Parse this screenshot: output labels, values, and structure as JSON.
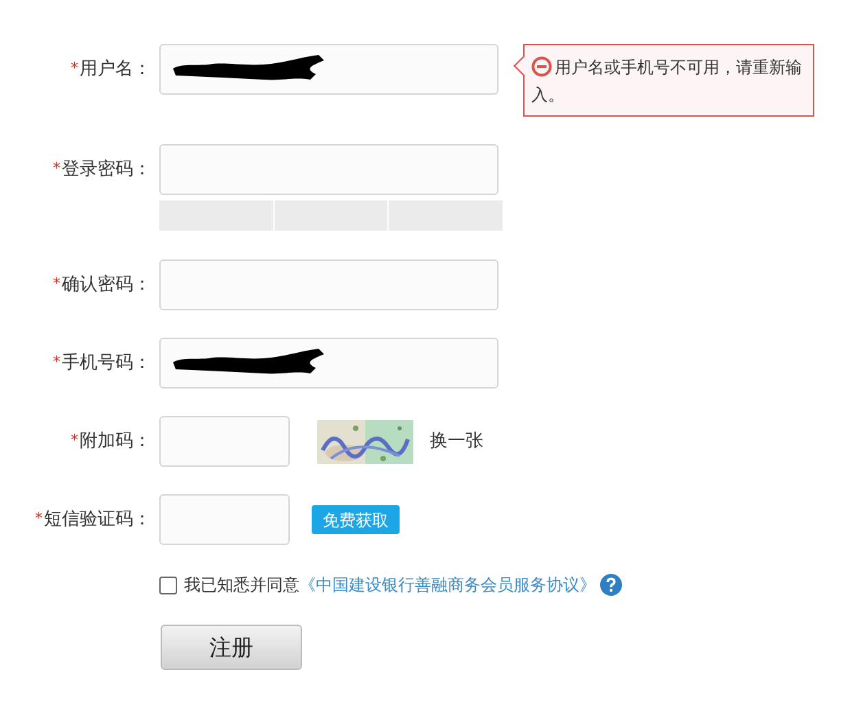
{
  "fields": [
    {
      "kind": "text",
      "label": "用户名：",
      "marker": "*",
      "redacted": true,
      "error": "用户名或手机号不可用，请重新输入。"
    },
    {
      "kind": "password",
      "label": "登录密码：",
      "marker": "*",
      "redacted": false
    },
    {
      "kind": "text",
      "label": "确认密码：",
      "marker": "*",
      "redacted": false
    },
    {
      "kind": "text",
      "label": "手机号码：",
      "marker": "*",
      "redacted": true
    },
    {
      "kind": "captcha",
      "label": "附加码：",
      "marker": "*",
      "redacted": false,
      "refresh": "换一张"
    },
    {
      "kind": "sms",
      "label": "短信验证码：",
      "marker": "*",
      "redacted": false,
      "button": "免费获取"
    }
  ],
  "agreement": {
    "checked": false,
    "text": "我已知悉并同意",
    "link": "《中国建设银行善融商务会员服务协议》"
  },
  "submit": "注册"
}
